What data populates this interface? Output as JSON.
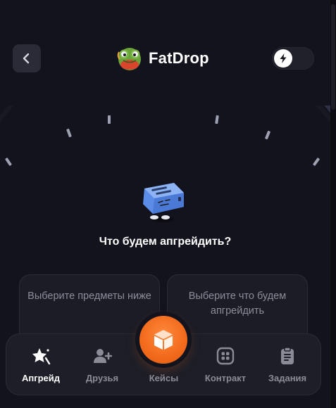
{
  "header": {
    "back_icon": "chevron-left-icon",
    "logo_text": "FatDrop",
    "logo_image": "frog-mascot",
    "toggle_icon": "lightning-icon"
  },
  "upgrade": {
    "prompt": "Что будем апгрейдить?",
    "item_image": "blue-toaster-item"
  },
  "cards": {
    "left_text": "Выберите предметы ниже",
    "right_text": "Выберите что будем апгрейдить"
  },
  "nav": {
    "items": [
      {
        "label": "Апгрейд",
        "icon": "sparkle-star-icon",
        "active": true
      },
      {
        "label": "Друзья",
        "icon": "add-user-icon",
        "active": false
      },
      {
        "label": "Кейсы",
        "icon": "box-icon",
        "active": false
      },
      {
        "label": "Контракт",
        "icon": "grid-icon",
        "active": false
      },
      {
        "label": "Задания",
        "icon": "clipboard-icon",
        "active": false
      }
    ]
  },
  "colors": {
    "background": "#13131d",
    "accent": "#f26a1b",
    "card": "#1b1c26",
    "arc": "#2e3145"
  }
}
